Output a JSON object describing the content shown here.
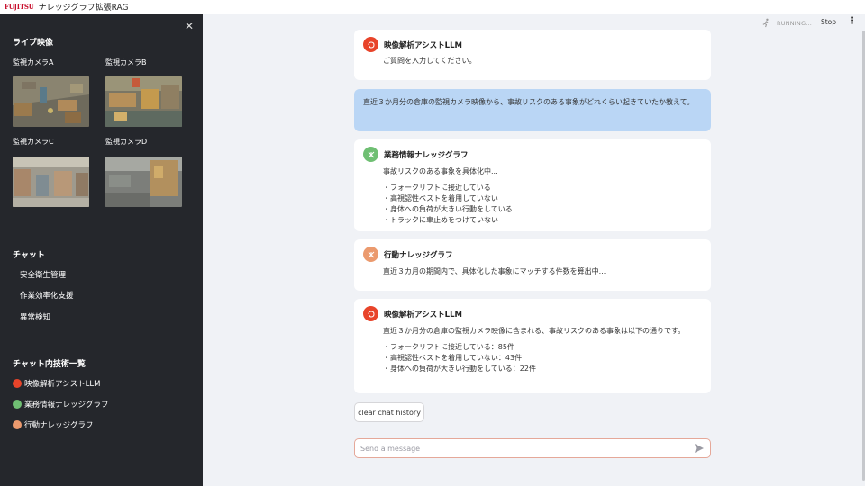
{
  "topbar": {
    "logo": "FUJITSU",
    "title": "ナレッジグラフ拡張RAG"
  },
  "header": {
    "status": "RUNNING...",
    "stop": "Stop",
    "menu": "⋮"
  },
  "sidebar": {
    "close": "✕",
    "live_title": "ライブ映像",
    "cameras": [
      {
        "label": "監視カメラA"
      },
      {
        "label": "監視カメラB"
      },
      {
        "label": "監視カメラC"
      },
      {
        "label": "監視カメラD"
      }
    ],
    "chat_title": "チャット",
    "chat_items": [
      "安全衛生管理",
      "作業効率化支援",
      "異常検知"
    ],
    "tech_title": "チャット内技術一覧",
    "tech_items": [
      {
        "label": "映像解析アシストLLM",
        "color": "#e8442a"
      },
      {
        "label": "業務情報ナレッジグラフ",
        "color": "#6fbf73"
      },
      {
        "label": "行動ナレッジグラフ",
        "color": "#eb9a6e"
      }
    ]
  },
  "messages": {
    "m1": {
      "sender": "映像解析アシストLLM",
      "text": "ご質問を入力してください。"
    },
    "m2": {
      "text": "直近３か月分の倉庫の監視カメラ映像から、事故リスクのある事象がどれくらい起きていたか教えて。"
    },
    "m3": {
      "sender": "業務情報ナレッジグラフ",
      "text": "事故リスクのある事象を具体化中...",
      "bullets": [
        "・フォークリフトに接近している",
        "・高視認性ベストを着用していない",
        "・身体への負荷が大きい行動をしている",
        "・トラックに車止めをつけていない"
      ]
    },
    "m4": {
      "sender": "行動ナレッジグラフ",
      "text": "直近３カ月の期間内で、具体化した事象にマッチする件数を算出中..."
    },
    "m5": {
      "sender": "映像解析アシストLLM",
      "text": "直近３か月分の倉庫の監視カメラ映像に含まれる、事故リスクのある事象は以下の通りです。",
      "bullets": [
        "・フォークリフトに接近している：85件",
        "・高視認性ベストを着用していない：43件",
        "・身体への負荷が大きい行動をしている：22件"
      ]
    }
  },
  "clear_button": "clear chat history",
  "input": {
    "placeholder": "Send a message"
  }
}
